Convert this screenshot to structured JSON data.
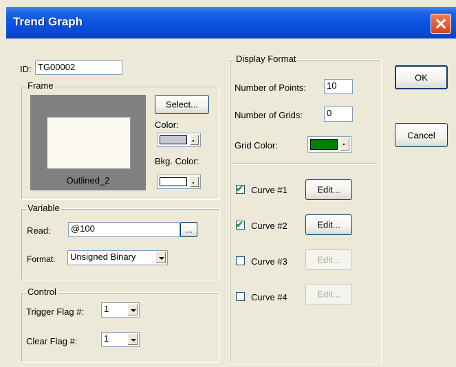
{
  "window": {
    "title": "Trend Graph"
  },
  "id": {
    "label": "ID:",
    "value": "TG00002"
  },
  "frame": {
    "group_label": "Frame",
    "preview_name": "Outlined_2",
    "select_label": "Select...",
    "color_label": "Color:",
    "bkg_color_label": "Bkg. Color:",
    "color_value": "#c8c8d0",
    "bkg_color_value": "#ffffff",
    "frame_gray": "#808080"
  },
  "variable": {
    "group_label": "Variable",
    "read_label": "Read:",
    "read_value": "@100",
    "browse_label": "...",
    "format_label": "Format:",
    "format_value": "Unsigned Binary"
  },
  "control": {
    "group_label": "Control",
    "trigger_label": "Trigger Flag #:",
    "trigger_value": "1",
    "clear_label": "Clear Flag #:",
    "clear_value": "1"
  },
  "display": {
    "group_label": "Display Format",
    "points_label": "Number of Points:",
    "points_value": "10",
    "grids_label": "Number of Grids:",
    "grids_value": "0",
    "grid_color_label": "Grid Color:",
    "grid_color_value": "#008000"
  },
  "curves": [
    {
      "label": "Curve #1",
      "checked": true,
      "edit_label": "Edit...",
      "edit_enabled": true
    },
    {
      "label": "Curve #2",
      "checked": true,
      "edit_label": "Edit...",
      "edit_enabled": true
    },
    {
      "label": "Curve #3",
      "checked": false,
      "edit_label": "Edit...",
      "edit_enabled": false
    },
    {
      "label": "Curve #4",
      "checked": false,
      "edit_label": "Edit...",
      "edit_enabled": false
    }
  ],
  "buttons": {
    "ok_label": "OK",
    "cancel_label": "Cancel"
  }
}
